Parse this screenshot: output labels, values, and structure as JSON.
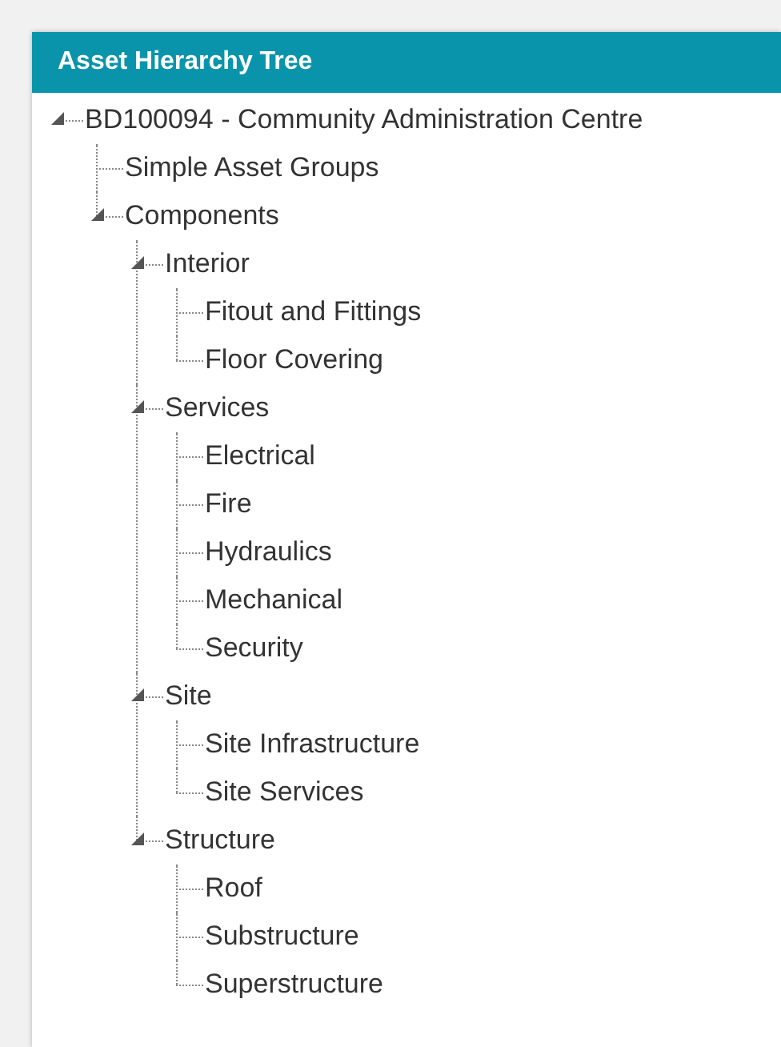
{
  "panel": {
    "title": "Asset Hierarchy Tree"
  },
  "tree": [
    {
      "label": "BD100094 - Community Administration Centre",
      "expanded": true,
      "children": [
        {
          "label": "Simple Asset Groups"
        },
        {
          "label": "Components",
          "expanded": true,
          "children": [
            {
              "label": "Interior",
              "expanded": true,
              "children": [
                {
                  "label": "Fitout and Fittings"
                },
                {
                  "label": "Floor Covering"
                }
              ]
            },
            {
              "label": "Services",
              "expanded": true,
              "children": [
                {
                  "label": "Electrical"
                },
                {
                  "label": "Fire"
                },
                {
                  "label": "Hydraulics"
                },
                {
                  "label": "Mechanical"
                },
                {
                  "label": "Security"
                }
              ]
            },
            {
              "label": "Site",
              "expanded": true,
              "children": [
                {
                  "label": "Site Infrastructure"
                },
                {
                  "label": "Site Services"
                }
              ]
            },
            {
              "label": "Structure",
              "expanded": true,
              "children": [
                {
                  "label": "Roof"
                },
                {
                  "label": "Substructure"
                },
                {
                  "label": "Superstructure"
                }
              ]
            }
          ]
        }
      ]
    }
  ]
}
